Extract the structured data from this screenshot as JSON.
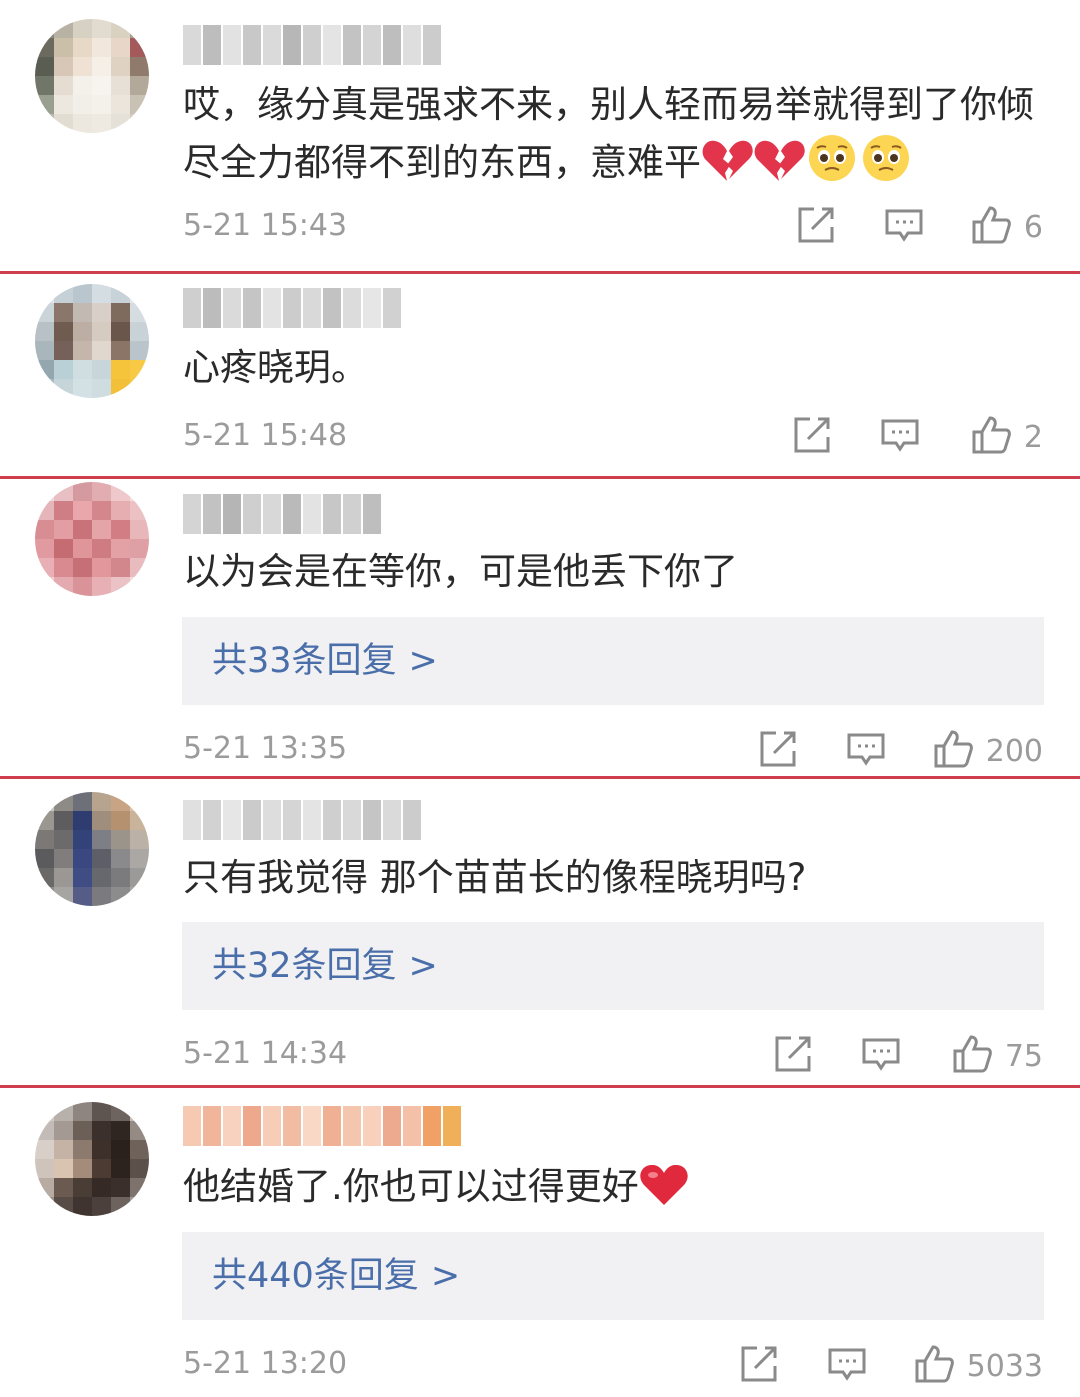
{
  "comments": [
    {
      "text": "哎，缘分真是强求不来，别人轻而易举就得到了你倾尽全力都得不到的东西，意难平",
      "emojis": [
        "broken-heart",
        "broken-heart",
        "pleading-face",
        "pleading-face"
      ],
      "time": "5-21 15:43",
      "likes": "6",
      "replies": null
    },
    {
      "text": "心疼晓玥。",
      "emojis": [],
      "time": "5-21 15:48",
      "likes": "2",
      "replies": null
    },
    {
      "text": "以为会是在等你，可是他丢下你了",
      "emojis": [],
      "time": "5-21 13:35",
      "likes": "200",
      "replies": "共33条回复"
    },
    {
      "text": "只有我觉得 那个苗苗长的像程晓玥吗?",
      "emojis": [],
      "time": "5-21 14:34",
      "likes": "75",
      "replies": "共32条回复"
    },
    {
      "text": "他结婚了.你也可以过得更好",
      "emojis": [
        "red-heart"
      ],
      "time": "5-21 13:20",
      "likes": "5033",
      "replies": "共440条回复"
    }
  ],
  "reply_arrow": ">",
  "colors": {
    "divider": "#cf3e4d",
    "reply_link": "#4a6ea9",
    "meta": "#9b9b9b",
    "reply_bg": "#f1f1f3"
  }
}
